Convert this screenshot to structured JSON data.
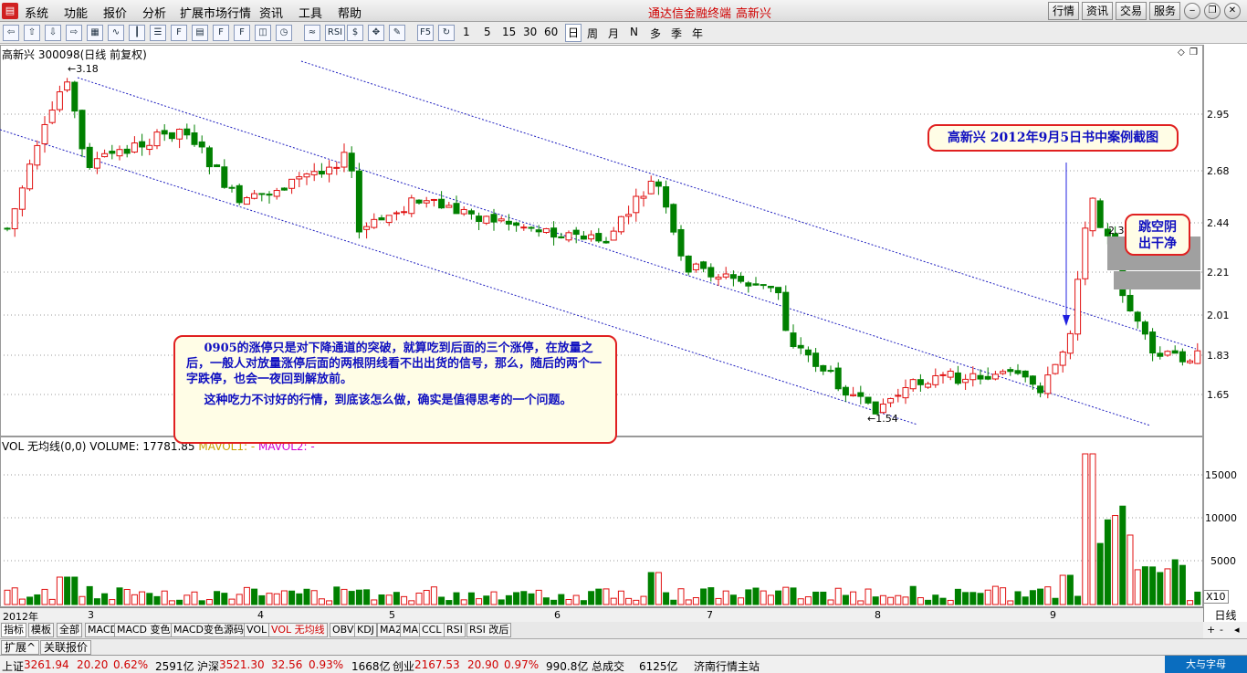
{
  "menubar": {
    "items": [
      "系统",
      "功能",
      "报价",
      "分析",
      "扩展市场行情",
      "资讯",
      "工具",
      "帮助"
    ],
    "app_title": "通达信金融终端",
    "stock_name": "高新兴",
    "right_buttons": [
      "行情",
      "资讯",
      "交易",
      "服务"
    ]
  },
  "toolbar": {
    "periods": [
      "1",
      "5",
      "15",
      "30",
      "60",
      "日",
      "周",
      "月",
      "N",
      "多",
      "季",
      "年"
    ],
    "active_period": "日"
  },
  "chart": {
    "title": "高新兴 300098(日线 前复权)",
    "price_axis": [
      "2.95",
      "2.68",
      "2.44",
      "2.21",
      "2.01",
      "1.83",
      "1.65"
    ],
    "high_label": "3.18",
    "low_label": "1.54",
    "gap_label": "2.3"
  },
  "volume": {
    "title": "VOL 无均线(0,0) VOLUME: 17781.85",
    "mavol1": "MAVOL1: -",
    "mavol2": "MAVOL2: -",
    "axis": [
      "15000",
      "10000",
      "5000"
    ],
    "unit": "X10"
  },
  "timeaxis": {
    "labels": [
      "2012年",
      "3",
      "4",
      "5",
      "6",
      "7",
      "8",
      "9"
    ],
    "period_box": "日线"
  },
  "indicator_tabs": [
    "指标",
    "模板",
    "全部",
    "MACD",
    "MACD 变色",
    "MACD变色源码",
    "VOL",
    "VOL 无均线",
    "OBV",
    "KDJ",
    "MA2",
    "MA",
    "CCL",
    "RSI",
    "RSI 改后"
  ],
  "bottom_tabs": [
    "扩展^",
    "关联报价"
  ],
  "statusbar": {
    "sh_label": "上证",
    "sh_value": "3261.94",
    "sh_change": "20.20",
    "sh_pct": "0.62%",
    "sh_amount": "2591亿",
    "sz_label": "沪深",
    "sz_value": "3521.30",
    "sz_change": "32.56",
    "sz_pct": "0.93%",
    "sz_amount": "1668亿",
    "cy_label": "创业",
    "cy_value": "2167.53",
    "cy_change": "20.90",
    "cy_pct": "0.97%",
    "cy_amount": "990.8亿",
    "total_label": "总成交",
    "total_value": "6125亿",
    "station": "济南行情主站",
    "brand": "大与字母"
  },
  "annotations": {
    "top": "高新兴 2012年9月5日书中案例截图",
    "gap_line1": "跳空阴",
    "gap_line2": "出干净",
    "main_p1": "0905的涨停只是对下降通道的突破，就算吃到后面的三个涨停，在放量之后，一般人对放量涨停后面的两根阴线看不出出货的信号，那么，随后的两个一字跌停，也会一夜回到解放前。",
    "main_p2": "这种吃力不讨好的行情，到底该怎么做，确实是值得思考的一个问题。"
  },
  "colors": {
    "up": "#e01010",
    "down": "#008000",
    "channel": "#2020c0",
    "callout_border": "#e02020",
    "callout_text": "#1010c0"
  }
}
